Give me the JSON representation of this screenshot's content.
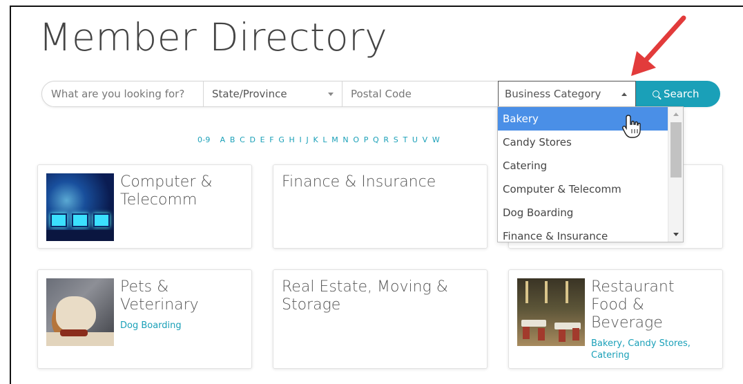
{
  "page": {
    "title": "Member Directory"
  },
  "search": {
    "keyword_placeholder": "What are you looking for?",
    "state_label": "State/Province",
    "postal_placeholder": "Postal Code",
    "category_label": "Business Category",
    "search_label": "Search"
  },
  "alphabet": [
    "0-9",
    "A",
    "B",
    "C",
    "D",
    "E",
    "F",
    "G",
    "H",
    "I",
    "J",
    "K",
    "L",
    "M",
    "N",
    "O",
    "P",
    "Q",
    "R",
    "S",
    "T",
    "U",
    "V",
    "W"
  ],
  "category_dropdown": {
    "options": [
      "Bakery",
      "Candy Stores",
      "Catering",
      "Computer & Telecomm",
      "Dog Boarding",
      "Finance & Insurance"
    ],
    "selected": "Bakery"
  },
  "cards": [
    {
      "title": "Computer & Telecomm",
      "title_lines": [
        "Computer &",
        "Telecomm"
      ],
      "image": "computer-monitors"
    },
    {
      "title": "Finance & Insurance",
      "image": null
    },
    {
      "title": "Pets & Veterinary",
      "title_lines": [
        "Pets &",
        "Veterinary"
      ],
      "subcategories": [
        "Dog Boarding"
      ],
      "image": "dog"
    },
    {
      "title": "Real Estate, Moving & Storage",
      "title_lines": [
        "Real Estate, Moving &",
        "Storage"
      ],
      "image": null
    },
    {
      "title": "Restaurant Food & Beverage",
      "title_lines": [
        "Restaurant",
        "Food &",
        "Beverage"
      ],
      "subcategories": [
        "Bakery",
        "Candy Stores",
        "Catering"
      ],
      "image": "restaurant"
    }
  ],
  "colors": {
    "accent": "#1aa0b8",
    "selected": "#4a8fe7",
    "arrow": "#e23b3b"
  },
  "icons": {
    "search": "magnifier-icon",
    "arrow": "red-arrow-annotation",
    "cursor": "hand-pointer-icon"
  }
}
